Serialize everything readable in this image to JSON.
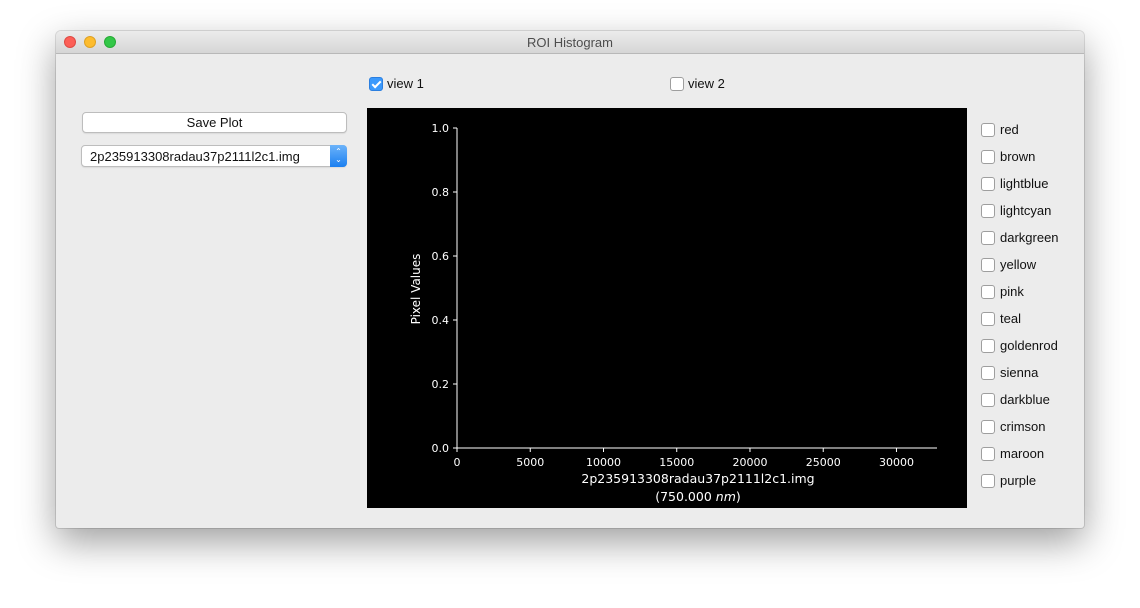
{
  "window": {
    "title": "ROI Histogram"
  },
  "views": [
    {
      "label": "view 1",
      "checked": true
    },
    {
      "label": "view 2",
      "checked": false
    }
  ],
  "toolbar": {
    "save_label": "Save Plot"
  },
  "file_select": {
    "value": "2p235913308radau37p2111l2c1.img"
  },
  "colors": [
    {
      "label": "red",
      "checked": false
    },
    {
      "label": "brown",
      "checked": false
    },
    {
      "label": "lightblue",
      "checked": false
    },
    {
      "label": "lightcyan",
      "checked": false
    },
    {
      "label": "darkgreen",
      "checked": false
    },
    {
      "label": "yellow",
      "checked": false
    },
    {
      "label": "pink",
      "checked": false
    },
    {
      "label": "teal",
      "checked": false
    },
    {
      "label": "goldenrod",
      "checked": false
    },
    {
      "label": "sienna",
      "checked": false
    },
    {
      "label": "darkblue",
      "checked": false
    },
    {
      "label": "crimson",
      "checked": false
    },
    {
      "label": "maroon",
      "checked": false
    },
    {
      "label": "purple",
      "checked": false
    }
  ],
  "chart_data": {
    "type": "line",
    "title": "",
    "xlabel_line1": "2p235913308radau37p2111l2c1.img",
    "xlabel_line2_prefix": "(750.000 ",
    "xlabel_line2_unit": "nm",
    "xlabel_line2_suffix": ")",
    "ylabel": "Pixel Values",
    "xlim": [
      0,
      32767
    ],
    "ylim": [
      0,
      1
    ],
    "x_ticks": [
      "0",
      "5000",
      "10000",
      "15000",
      "20000",
      "25000",
      "30000"
    ],
    "y_ticks": [
      "0.0",
      "0.2",
      "0.4",
      "0.6",
      "0.8",
      "1.0"
    ],
    "series": [],
    "background": "#000000",
    "foreground": "#ffffff",
    "grid": false
  }
}
